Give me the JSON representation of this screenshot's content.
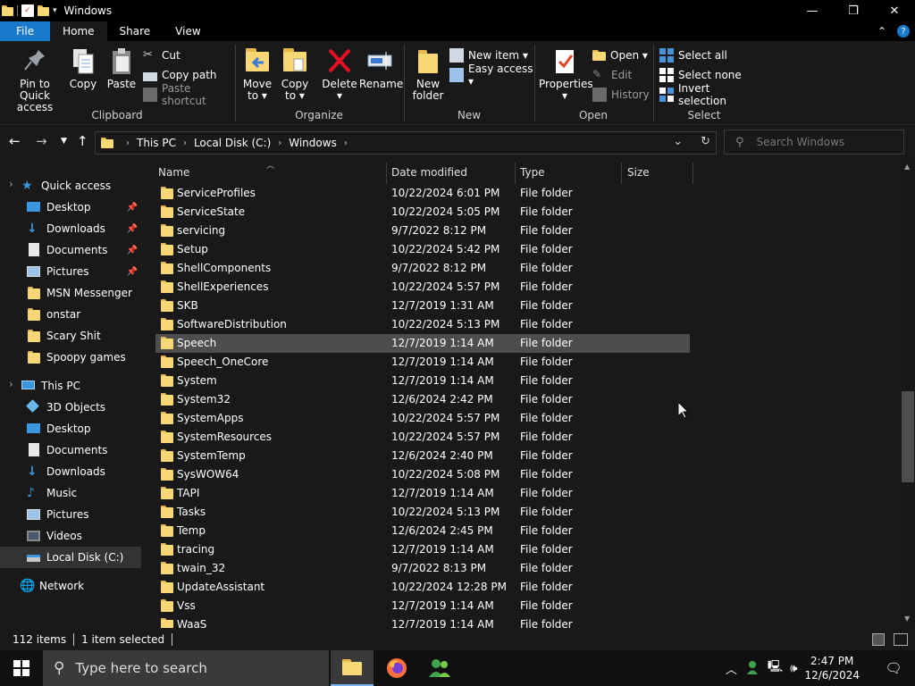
{
  "window": {
    "title": "Windows",
    "min": "—",
    "max": "❐",
    "close": "✕"
  },
  "tabs": {
    "file": "File",
    "home": "Home",
    "share": "Share",
    "view": "View",
    "collapse": "⌃",
    "help": "?"
  },
  "ribbon": {
    "clipboard": {
      "label": "Clipboard",
      "pin": "Pin to Quick\naccess",
      "copy": "Copy",
      "paste": "Paste",
      "cut": "Cut",
      "copy_path": "Copy path",
      "paste_shortcut": "Paste shortcut"
    },
    "organize": {
      "label": "Organize",
      "move_to": "Move\nto ▾",
      "copy_to": "Copy\nto ▾",
      "delete": "Delete\n▾",
      "rename": "Rename"
    },
    "new": {
      "label": "New",
      "new_folder": "New\nfolder",
      "new_item": "New item ▾",
      "easy_access": "Easy access ▾"
    },
    "open": {
      "label": "Open",
      "properties": "Properties\n▾",
      "open": "Open ▾",
      "edit": "Edit",
      "history": "History"
    },
    "select": {
      "label": "Select",
      "select_all": "Select all",
      "select_none": "Select none",
      "invert": "Invert selection"
    }
  },
  "address": {
    "crumbs": [
      "This PC",
      "Local Disk (C:)",
      "Windows"
    ],
    "search_placeholder": "Search Windows"
  },
  "sidebar": {
    "items": [
      {
        "label": "Quick access",
        "icon": "star-icon",
        "pinned": false
      },
      {
        "label": "Desktop",
        "icon": "desktop-icon",
        "pinned": true
      },
      {
        "label": "Downloads",
        "icon": "download-icon",
        "pinned": true
      },
      {
        "label": "Documents",
        "icon": "documents-icon",
        "pinned": true
      },
      {
        "label": "Pictures",
        "icon": "pictures-icon",
        "pinned": true
      },
      {
        "label": "MSN Messenger",
        "icon": "folder-icon",
        "pinned": false
      },
      {
        "label": "onstar",
        "icon": "folder-icon",
        "pinned": false
      },
      {
        "label": "Scary Shit",
        "icon": "folder-icon",
        "pinned": false
      },
      {
        "label": "Spoopy games",
        "icon": "folder-icon",
        "pinned": false
      },
      {
        "label": "This PC",
        "icon": "computer-icon",
        "pinned": false
      },
      {
        "label": "3D Objects",
        "icon": "cube-icon",
        "pinned": false
      },
      {
        "label": "Desktop",
        "icon": "desktop-icon",
        "pinned": false
      },
      {
        "label": "Documents",
        "icon": "documents-icon",
        "pinned": false
      },
      {
        "label": "Downloads",
        "icon": "download-icon",
        "pinned": false
      },
      {
        "label": "Music",
        "icon": "music-icon",
        "pinned": false
      },
      {
        "label": "Pictures",
        "icon": "pictures-icon",
        "pinned": false
      },
      {
        "label": "Videos",
        "icon": "videos-icon",
        "pinned": false
      },
      {
        "label": "Local Disk (C:)",
        "icon": "drive-icon",
        "pinned": false
      },
      {
        "label": "Network",
        "icon": "network-icon",
        "pinned": false
      }
    ]
  },
  "columns": {
    "name": "Name",
    "date": "Date modified",
    "type": "Type",
    "size": "Size"
  },
  "files": [
    {
      "name": "ServiceProfiles",
      "date": "10/22/2024 6:01 PM",
      "type": "File folder"
    },
    {
      "name": "ServiceState",
      "date": "10/22/2024 5:05 PM",
      "type": "File folder"
    },
    {
      "name": "servicing",
      "date": "9/7/2022 8:12 PM",
      "type": "File folder"
    },
    {
      "name": "Setup",
      "date": "10/22/2024 5:42 PM",
      "type": "File folder"
    },
    {
      "name": "ShellComponents",
      "date": "9/7/2022 8:12 PM",
      "type": "File folder"
    },
    {
      "name": "ShellExperiences",
      "date": "10/22/2024 5:57 PM",
      "type": "File folder"
    },
    {
      "name": "SKB",
      "date": "12/7/2019 1:31 AM",
      "type": "File folder"
    },
    {
      "name": "SoftwareDistribution",
      "date": "10/22/2024 5:13 PM",
      "type": "File folder"
    },
    {
      "name": "Speech",
      "date": "12/7/2019 1:14 AM",
      "type": "File folder",
      "selected": true
    },
    {
      "name": "Speech_OneCore",
      "date": "12/7/2019 1:14 AM",
      "type": "File folder"
    },
    {
      "name": "System",
      "date": "12/7/2019 1:14 AM",
      "type": "File folder"
    },
    {
      "name": "System32",
      "date": "12/6/2024 2:42 PM",
      "type": "File folder"
    },
    {
      "name": "SystemApps",
      "date": "10/22/2024 5:57 PM",
      "type": "File folder"
    },
    {
      "name": "SystemResources",
      "date": "10/22/2024 5:57 PM",
      "type": "File folder"
    },
    {
      "name": "SystemTemp",
      "date": "12/6/2024 2:40 PM",
      "type": "File folder"
    },
    {
      "name": "SysWOW64",
      "date": "10/22/2024 5:08 PM",
      "type": "File folder"
    },
    {
      "name": "TAPI",
      "date": "12/7/2019 1:14 AM",
      "type": "File folder"
    },
    {
      "name": "Tasks",
      "date": "10/22/2024 5:13 PM",
      "type": "File folder"
    },
    {
      "name": "Temp",
      "date": "12/6/2024 2:45 PM",
      "type": "File folder"
    },
    {
      "name": "tracing",
      "date": "12/7/2019 1:14 AM",
      "type": "File folder"
    },
    {
      "name": "twain_32",
      "date": "9/7/2022 8:13 PM",
      "type": "File folder"
    },
    {
      "name": "UpdateAssistant",
      "date": "10/22/2024 12:28 PM",
      "type": "File folder"
    },
    {
      "name": "Vss",
      "date": "12/7/2019 1:14 AM",
      "type": "File folder"
    },
    {
      "name": "WaaS",
      "date": "12/7/2019 1:14 AM",
      "type": "File folder"
    }
  ],
  "status": {
    "items": "112 items",
    "selected": "1 item selected"
  },
  "taskbar": {
    "search_placeholder": "Type here to search",
    "time": "2:47 PM",
    "date": "12/6/2024"
  },
  "colors": {
    "accent": "#1979ca",
    "folder": "#f8d775",
    "selected_row": "#4d4d4d",
    "background": "#191919"
  }
}
